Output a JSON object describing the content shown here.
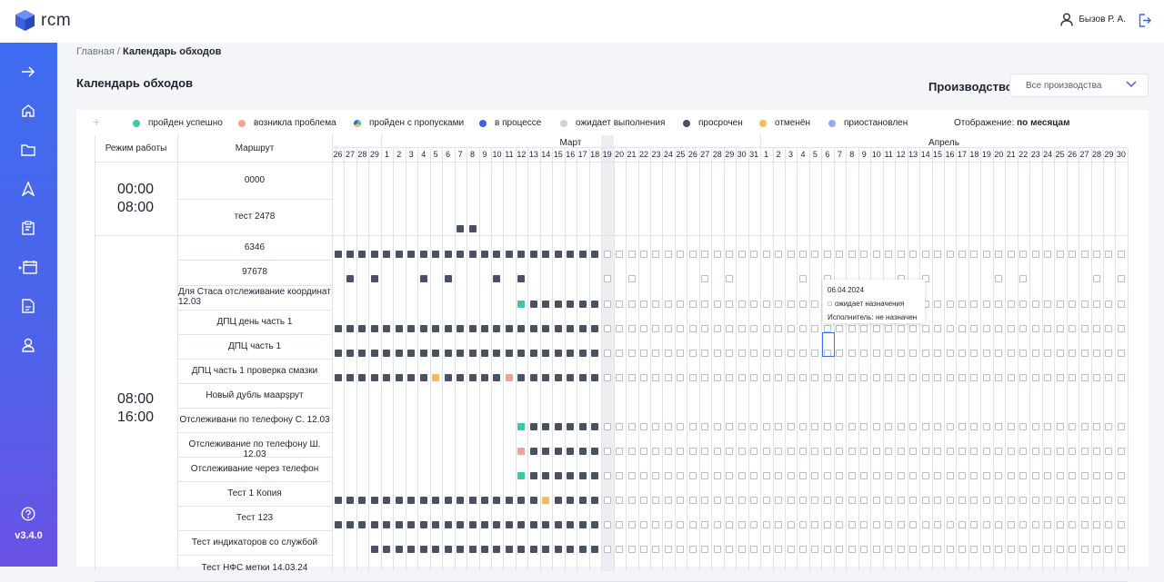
{
  "app": {
    "name": "rcm",
    "version": "v3.4.0",
    "user": "Бызов Р. А."
  },
  "sidebar": {
    "icons": [
      "arrow-right-icon",
      "home-icon",
      "folder-icon",
      "navigate-icon",
      "clipboard-icon",
      "calendar-icon",
      "document-icon",
      "user-icon"
    ],
    "help_icon": "help-icon"
  },
  "breadcrumb": {
    "home": "Главная",
    "separator": " / ",
    "current": "Календарь обходов"
  },
  "page": {
    "title": "Календарь обходов"
  },
  "production": {
    "label": "Производство",
    "selected": "Все производства"
  },
  "legend": {
    "items": [
      {
        "label": "пройден успешно",
        "color": "#3ac8a8"
      },
      {
        "label": "возникла проблема",
        "color": "#f0a396"
      },
      {
        "label": "пройден с пропусками",
        "color": "multi"
      },
      {
        "label": "в процессе",
        "color": "#3d62e0"
      },
      {
        "label": "ожидает выполнения",
        "color": "#cdd3dd"
      },
      {
        "label": "просрочен",
        "color": "#4a5161"
      },
      {
        "label": "отменён",
        "color": "#f4bc60"
      },
      {
        "label": "приостановлен",
        "color": "#93a8ef"
      }
    ],
    "display_label": "Отображение:",
    "display_value": "по месяцам"
  },
  "table": {
    "col_mode": "Режим работы",
    "col_route": "Маршрут",
    "months": [
      "Март",
      "Апрель"
    ],
    "days": [
      "26",
      "27",
      "28",
      "29",
      "1",
      "2",
      "3",
      "4",
      "5",
      "6",
      "7",
      "8",
      "9",
      "10",
      "11",
      "12",
      "13",
      "14",
      "15",
      "16",
      "17",
      "18",
      "19",
      "20",
      "21",
      "22",
      "23",
      "24",
      "25",
      "26",
      "27",
      "28",
      "29",
      "30",
      "31",
      "1",
      "2",
      "3",
      "4",
      "5",
      "6",
      "7",
      "8",
      "9",
      "10",
      "11",
      "12",
      "13",
      "14",
      "15",
      "16",
      "17",
      "18",
      "19",
      "20",
      "21",
      "22",
      "23",
      "24",
      "25",
      "26",
      "27",
      "28",
      "29",
      "30"
    ],
    "today_index": 22,
    "groups": [
      {
        "mode": "00:00\n08:00",
        "rows": [
          0,
          1
        ]
      },
      {
        "mode": "08:00\n16:00",
        "rows": [
          2,
          3,
          4,
          5,
          6,
          7,
          8,
          9,
          10,
          11,
          12,
          13,
          14,
          15
        ]
      }
    ],
    "rows": [
      {
        "route": "0000",
        "cells": ""
      },
      {
        "route": "тест 2478",
        "cells": ""
      },
      {
        "route": "6346",
        "cells": "DDDDDDDDDDDDDDDDDDDDDDWWWWWWWWWWWWWWWWWWWWWWWWWWWWWWWWWWWWWWWWWWW"
      },
      {
        "route": "97678",
        "cells": "-D-D---D-D---D-D------W-W-----W-W-----W-W-----W-W-----W-W-----W-W"
      },
      {
        "route": "Для Стаса отслеживание координат 12.03",
        "cells": "---------------SDDDDDDWWWWWWWWWWWWWWWWWWWWWWWWWWWWWWWWWWWWWWWWWWW"
      },
      {
        "route": "ДПЦ день часть 1",
        "cells": "DDDDDDDDDDDDDDDDDDDDDDWWWWWWWWWWWWWWWWWWWWWWWWWWWWWWWWWWWWWWWWWWW"
      },
      {
        "route": "ДПЦ часть 1",
        "cells": "DDDDDDDDDDDDDDDDDDDDDDWWWWWWWWWWWWWWWWWWWWWWWWWWWWWWWWWWWWWWWWWWW"
      },
      {
        "route": "ДПЦ часть 1 проверка смазки",
        "cells": "DDDDDDDDCDDDDDPDDDDDDDWWWWWWWWWWWWWWWWWWWWWWWWWWWWWWWWWWWWWWWWWWW"
      },
      {
        "route": "Новый дубль маарşрут",
        "cells": ""
      },
      {
        "route": "Отслеживани по телефону С. 12.03",
        "cells": "---------------SDDDDDDWWWWWWWWWWWWWWWWWWWWWWWWWWWWWWWWWWWWWWWWWWW"
      },
      {
        "route": "Отслеживание по телефону Ш. 12.03",
        "cells": "---------------PDDDDDDWWWWWWWWWWWWWWWWWWWWWWWWWWWWWWWWWWWWWWWWWWW"
      },
      {
        "route": "Отслеживание через телефон",
        "cells": "---------------SDDDDDDWWWWWWWWWWWWWWWWWWWWWWWWWWWWWWWWWWWWWWWWWWW"
      },
      {
        "route": "Тест 1 Копия",
        "cells": "DDDDDDDDDDDDDDDDDCDDDDWWWWWWWWWWWWWWWWWWWWWWWWWWWWWWWWWWWWWWWWWWW"
      },
      {
        "route": "Тест 123",
        "cells": "DDDDDDDDDDDDDDDDDDDDDDWWWWWWWWWWWWWWWWWWWWWWWWWWWWWWWWWWWWWWWWWWW"
      },
      {
        "route": "Тест индикаторов со службой",
        "cells": "---DDDDDDDDDDDDDDDDDDDWWWWWWWWWWWWWWWWWWWWWWWWWWWWWWWWWWWWWWWWWWW"
      },
      {
        "route": "Тест НФС метки 14.03.24",
        "cells": ""
      }
    ],
    "extra": {
      "row1_done_days": [
        10,
        11
      ]
    }
  },
  "tooltip": {
    "date": "06.04.2024",
    "status": "ожидает назначения",
    "executor": "Исполнитель: не назначен"
  }
}
